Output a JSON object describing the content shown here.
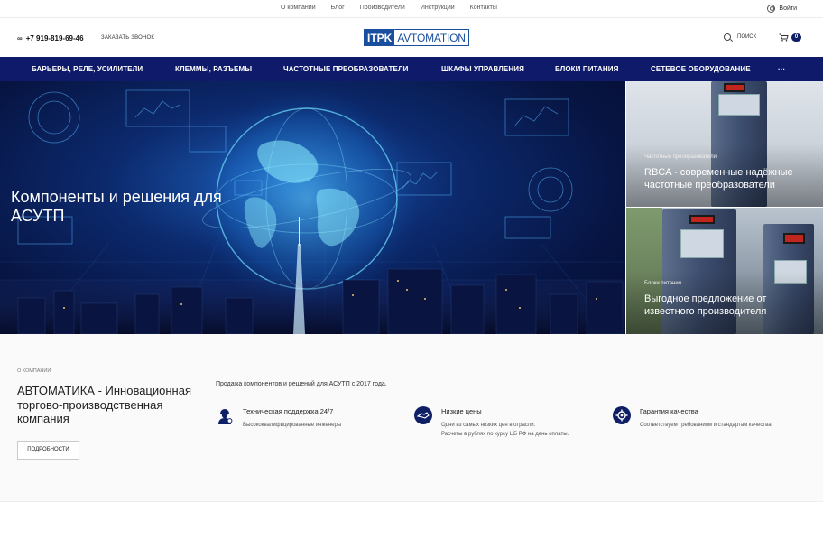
{
  "topbar": {
    "links": [
      "О компании",
      "Блог",
      "Производители",
      "Инструкции",
      "Контакты"
    ],
    "login": "Войти"
  },
  "header": {
    "phone": "+7 919-819-69-46",
    "callback": "Заказать звонок",
    "logo_part1": "ITPK",
    "logo_part2": "AVTOMATION",
    "search": "Поиск",
    "cart_count": "0"
  },
  "nav": {
    "items": [
      "Барьеры, реле, усилители",
      "Клеммы, разъемы",
      "Частотные преобразователи",
      "Шкафы управления",
      "Блоки питания",
      "Сетевое оборудование"
    ],
    "more": "···"
  },
  "hero": {
    "title": "Компоненты и решения для АСУТП"
  },
  "side_banners": [
    {
      "category": "Частотные преобразователи",
      "title": "RBCA - современные надёжные частотные преобразователи"
    },
    {
      "category": "Блоки питания",
      "title": "Выгодное предложение от известного производителя"
    }
  ],
  "about": {
    "label": "О компании",
    "heading": "АВТОМАТИКА - Инновационная торгово-производственная компания",
    "button": "Подробности",
    "intro": "Продажа компонентов и решений для АСУТП с 2017 года.",
    "features": [
      {
        "icon": "engineer-icon",
        "title": "Техническая поддержка 24/7",
        "desc": [
          "Высококвалифицированные инженеры"
        ]
      },
      {
        "icon": "handshake-icon",
        "title": "Низкие цены",
        "desc": [
          "Одни из самых низких цен в отрасли.",
          "Расчеты в рублях по курсу ЦБ РФ на день оплаты."
        ]
      },
      {
        "icon": "settings-icon",
        "title": "Гарантия качества",
        "desc": [
          "Соответствуем требованиям и стандартам качества"
        ]
      }
    ]
  },
  "colors": {
    "nav_bg": "#0f1a6b",
    "brand_blue": "#1a4fa0",
    "icon_bg": "#0f1f66"
  }
}
